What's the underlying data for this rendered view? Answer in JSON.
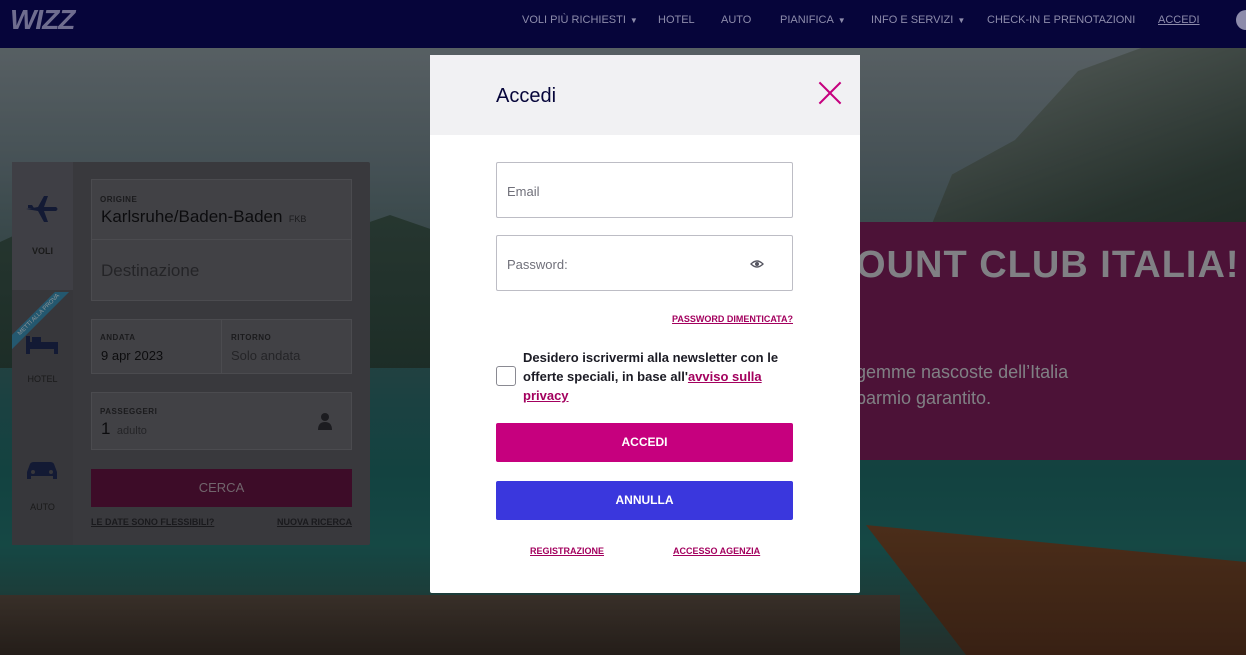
{
  "nav": {
    "logo": "WIZZ",
    "items": [
      {
        "label": "VOLI PIÙ RICHIESTI",
        "dropdown": true
      },
      {
        "label": "HOTEL",
        "dropdown": false
      },
      {
        "label": "AUTO",
        "dropdown": false
      },
      {
        "label": "PIANIFICA",
        "dropdown": true
      },
      {
        "label": "INFO E SERVIZI",
        "dropdown": true
      },
      {
        "label": "CHECK-IN E PRENOTAZIONI",
        "dropdown": false
      },
      {
        "label": "ACCEDI",
        "dropdown": false
      }
    ]
  },
  "promo": {
    "title": "OUNT CLUB ITALIA!",
    "line1": "gemme nascoste dell’Italia",
    "line2": "parmio garantito."
  },
  "search": {
    "tabs": [
      {
        "label": "VOLI",
        "icon": "plane-icon"
      },
      {
        "label": "HOTEL",
        "icon": "bed-icon"
      },
      {
        "label": "AUTO",
        "icon": "car-icon"
      }
    ],
    "ribbon": "METTI ALLA PROVA",
    "origin_label": "ORIGINE",
    "origin_value": "Karlsruhe/Baden-Baden",
    "origin_code": "FKB",
    "destination_placeholder": "Destinazione",
    "departure_label": "ANDATA",
    "departure_value": "9 apr 2023",
    "return_label": "RITORNO",
    "return_value": "Solo andata",
    "passengers_label": "PASSEGGERI",
    "passengers_count": "1",
    "passengers_unit": "adulto",
    "search_button": "CERCA",
    "flexible_link": "LE DATE SONO FLESSIBILI?",
    "new_search_link": "NUOVA RICERCA"
  },
  "modal": {
    "title": "Accedi",
    "email_placeholder": "Email",
    "password_placeholder": "Password:",
    "forgot_password": "PASSWORD DIMENTICATA?",
    "newsletter_text": "Desidero iscrivermi alla newsletter con le offerte speciali, in base all'",
    "privacy_link": "avviso sulla privacy",
    "login_button": "ACCEDI",
    "cancel_button": "ANNULLA",
    "register_link": "REGISTRAZIONE",
    "agency_link": "ACCESSO AGENZIA"
  },
  "colors": {
    "brand_magenta": "#c6007e",
    "brand_navy": "#06053a",
    "cancel_blue": "#3a37dd"
  }
}
